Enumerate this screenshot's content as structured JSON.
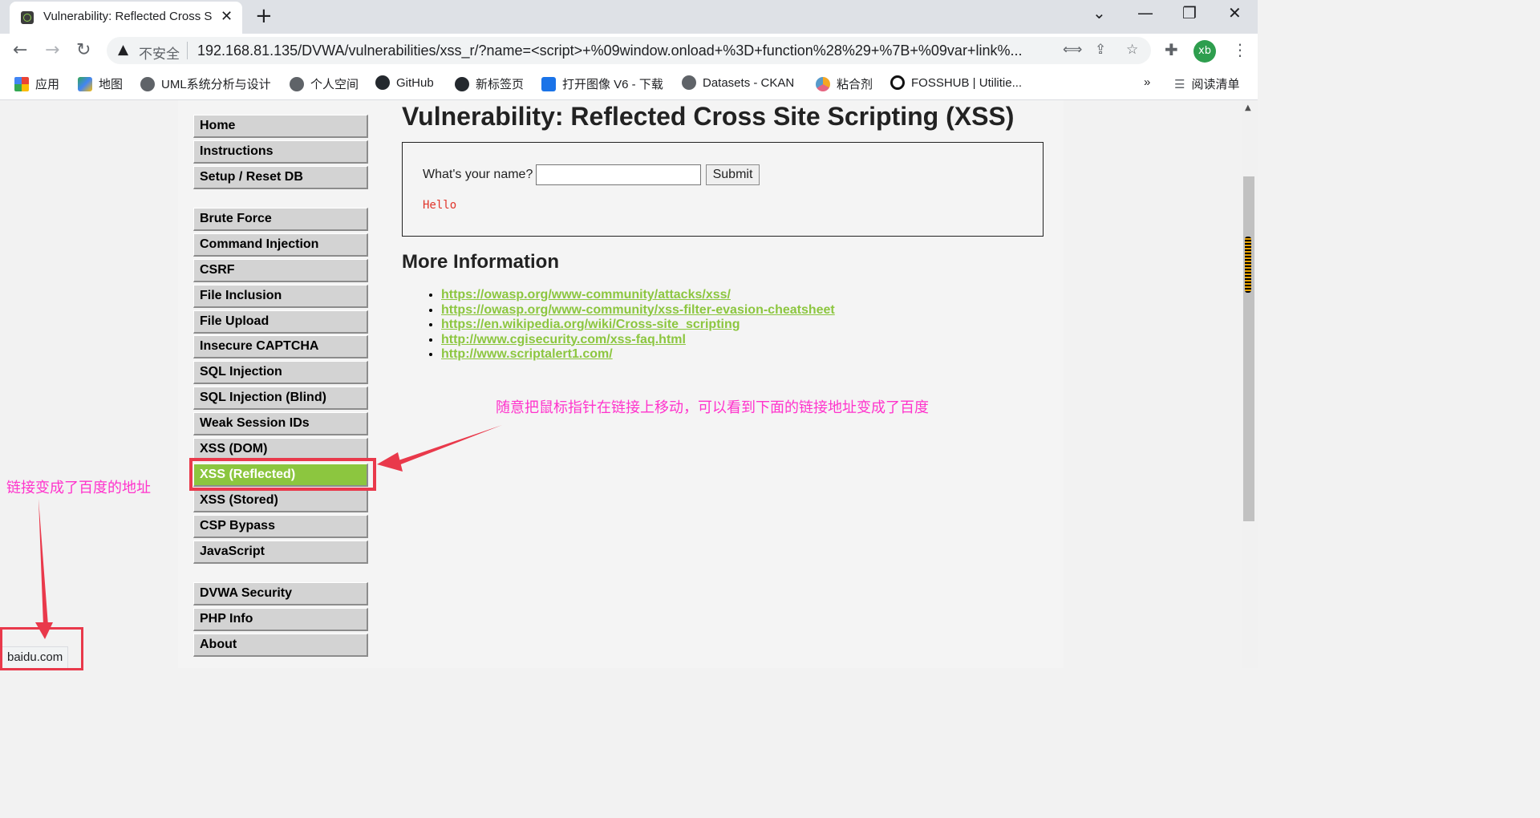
{
  "browser": {
    "tab_title": "Vulnerability: Reflected Cross S",
    "tab_close": "✕",
    "new_tab": "+",
    "window_controls": [
      "⌄",
      "—",
      "❐",
      "✕"
    ],
    "nav": {
      "back": "←",
      "forward": "→",
      "reload": "↻"
    },
    "security_icon": "warning-triangle-icon",
    "security_label": "不安全",
    "url": "192.168.81.135/DVWA/vulnerabilities/xss_r/?name=<script>+%09window.onload+%3D+function%28%29+%7B+%09var+link%...",
    "profile_initials": "xb",
    "bookmarks": [
      {
        "label": "应用",
        "icon": "apps-grid-icon"
      },
      {
        "label": "地图",
        "icon": "maps-icon"
      },
      {
        "label": "UML系统分析与设计",
        "icon": "globe-icon"
      },
      {
        "label": "个人空间",
        "icon": "globe-icon"
      },
      {
        "label": "GitHub",
        "icon": "github-icon"
      },
      {
        "label": "新标签页",
        "icon": "github-icon"
      },
      {
        "label": "打开图像 V6 - 下载",
        "icon": "image-open-icon"
      },
      {
        "label": "Datasets - CKAN",
        "icon": "globe-icon"
      },
      {
        "label": "粘合剂",
        "icon": "binder-icon"
      },
      {
        "label": "FOSSHUB | Utilitie...",
        "icon": "fosshub-icon"
      }
    ],
    "bookmarks_overflow": "»",
    "reading_list": "阅读清单",
    "status_url": "baidu.com"
  },
  "dvwa": {
    "menu": {
      "group1": [
        "Home",
        "Instructions",
        "Setup / Reset DB"
      ],
      "group2": [
        "Brute Force",
        "Command Injection",
        "CSRF",
        "File Inclusion",
        "File Upload",
        "Insecure CAPTCHA",
        "SQL Injection",
        "SQL Injection (Blind)",
        "Weak Session IDs",
        "XSS (DOM)",
        "XSS (Reflected)",
        "XSS (Stored)",
        "CSP Bypass",
        "JavaScript"
      ],
      "group3": [
        "DVWA Security",
        "PHP Info",
        "About"
      ],
      "active": "XSS (Reflected)"
    },
    "title": "Vulnerability: Reflected Cross Site Scripting (XSS)",
    "form": {
      "label": "What's your name?",
      "input_value": "",
      "submit": "Submit"
    },
    "output": "Hello",
    "more_info_title": "More Information",
    "links": [
      "https://owasp.org/www-community/attacks/xss/",
      "https://owasp.org/www-community/xss-filter-evasion-cheatsheet",
      "https://en.wikipedia.org/wiki/Cross-site_scripting",
      "http://www.cgisecurity.com/xss-faq.html",
      "http://www.scriptalert1.com/"
    ]
  },
  "annotations": {
    "right_note": "随意把鼠标指针在链接上移动，可以看到下面的链接地址变成了百度",
    "left_note": "链接变成了百度的地址"
  },
  "colors": {
    "accent_green": "#8cc63f",
    "annotation_magenta": "#ff33cc",
    "annotation_red": "#e9394b"
  }
}
